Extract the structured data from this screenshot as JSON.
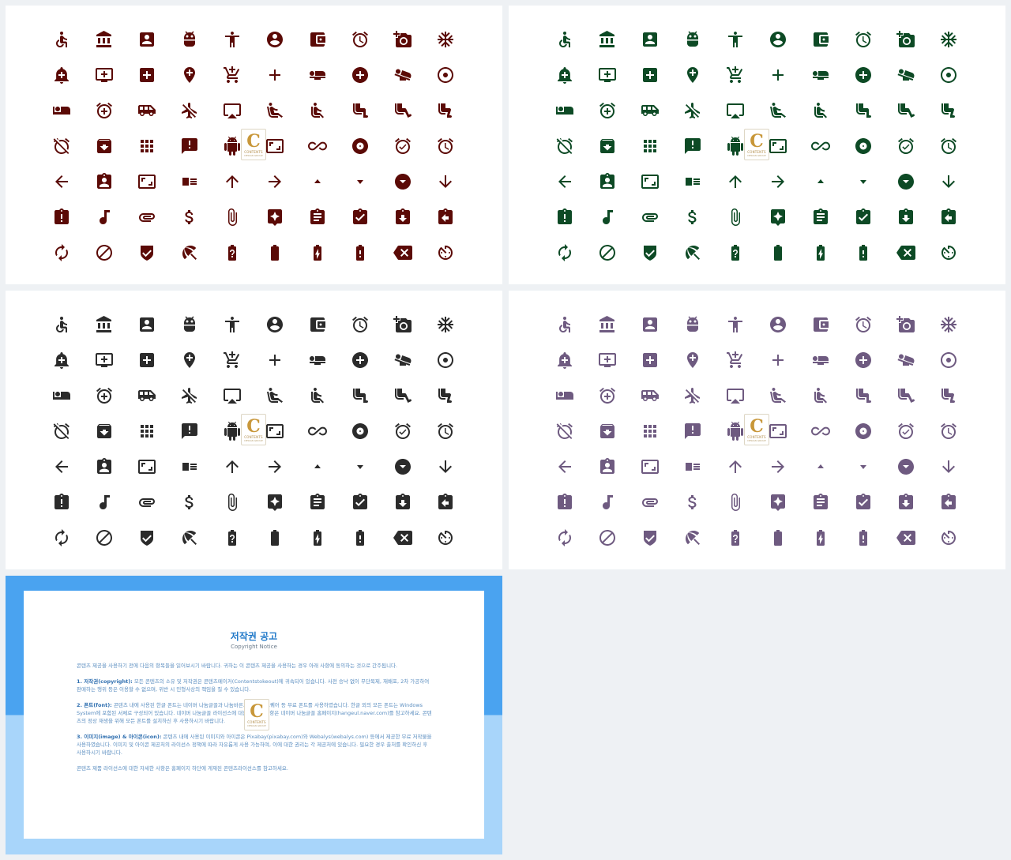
{
  "slides": [
    {
      "id": "maroon",
      "color": "#5b0a06"
    },
    {
      "id": "green",
      "color": "#0d4a25"
    },
    {
      "id": "dark",
      "color": "#2b2b2b"
    },
    {
      "id": "purple",
      "color": "#6e5a80"
    }
  ],
  "icons": [
    [
      "accessible-icon",
      "bank-icon",
      "account-box-icon",
      "android-icon",
      "accessibility-icon",
      "account-circle-icon",
      "wallet-icon",
      "alarm-icon",
      "add-a-photo-icon",
      "ac-unit-icon"
    ],
    [
      "add-alert-icon",
      "add-to-queue-icon",
      "add-box-icon",
      "add-location-icon",
      "add-shopping-cart-icon",
      "add-icon",
      "airline-seat-flat-icon",
      "add-circle-icon",
      "airline-seat-angled-icon",
      "adjust-icon"
    ],
    [
      "airline-seat-individual-suite-icon",
      "alarm-add-icon",
      "airport-shuttle-icon",
      "airplanemode-inactive-icon",
      "airplay-icon",
      "airline-seat-recline-extra-icon",
      "airline-seat-recline-normal-icon",
      "airline-seat-legroom-normal-icon",
      "airline-seat-legroom-extra-icon",
      "airline-seat-legroom-reduced-icon"
    ],
    [
      "alarm-off-icon",
      "archive-icon",
      "apps-icon",
      "announcement-icon",
      "android-robot-icon",
      "aspect-ratio-icon",
      "all-inclusive-icon",
      "album-icon",
      "alarm-on-icon",
      "access-alarm-icon"
    ],
    [
      "arrow-back-icon",
      "assignment-ind-icon",
      "aspect-icon",
      "featured-video-icon",
      "arrow-upward-icon",
      "arrow-forward-icon",
      "arrow-drop-up-icon",
      "arrow-drop-down-icon",
      "arrow-drop-down-circle-icon",
      "arrow-downward-icon"
    ],
    [
      "assignment-late-icon",
      "audiotrack-icon",
      "attachment-icon",
      "attach-money-icon",
      "attach-file-icon",
      "assistant-icon",
      "assignment-icon",
      "assignment-turned-in-icon",
      "assignment-returned-icon",
      "assignment-return-icon"
    ],
    [
      "autorenew-icon",
      "block-icon",
      "security-icon",
      "beach-access-icon",
      "battery-unknown-icon",
      "battery-full-icon",
      "battery-charging-icon",
      "battery-alert-icon",
      "backspace-icon",
      "av-timer-icon"
    ]
  ],
  "watermark": {
    "letter": "C",
    "name": "CONTENTS",
    "sub": "DESIGN GROUP"
  },
  "notice": {
    "title": "저작권 공고",
    "subtitle": "Copyright Notice",
    "intro": "콘텐츠 제공을 사용하기 전에 다음의 항목들을 읽어보시기 바랍니다. 귀하는 이 콘텐츠 제공을 사용하는 경우 아래 사항에 동의하는 것으로 간주됩니다.",
    "sections": [
      {
        "label": "1. 저작권(copyright):",
        "text": "모든 콘텐츠의 소유 및 저작권은 콘텐츠메이커(Contentstokeout)에 귀속되어 있습니다. 사전 승낙 없이 무단복제, 재배포, 2차 가공하여 판매하는 행위 등은 이용할 수 없으며, 위반 시 민형사상의 책임을 질 수 있습니다."
      },
      {
        "label": "2. 폰트(font):",
        "text": "콘텐츠 내에 사용된 한글 폰트는 네이버 나눔글꼴과 나눔바른고딕, 나눔스퀘어 등 무료 폰트를 사용하였습니다. 한글 외의 모든 폰트는 Windows System에 포함된 서체로 구성되어 있습니다. 네이버 나눔글꼴 라이선스에 대한 자세한 사항은 네이버 나눔글꼴 홈페이지(hangeul.naver.com)를 참고하세요. 콘텐츠의 정상 재생을 위해 모든 폰트를 설치하신 후 사용하시기 바랍니다."
      },
      {
        "label": "3. 이미지(image) & 아이콘(icon):",
        "text": "콘텐츠 내에 사용된 이미지와 아이콘은 Pixabay(pixabay.com)와 Webalys(webalys.com) 등에서 제공한 무료 저작물을 사용하였습니다. 이미지 및 아이콘 제공처의 라이선스 정책에 따라 자유롭게 사용 가능하며, 이에 대한 권리는 각 제공처에 있습니다. 필요한 경우 출처를 확인하신 후 사용하시기 바랍니다."
      }
    ],
    "outro": "콘텐츠 제품 라이선스에 대한 자세한 사항은 홈페이지 하단에 게재된 콘텐츠라이선스를 참고하세요."
  }
}
